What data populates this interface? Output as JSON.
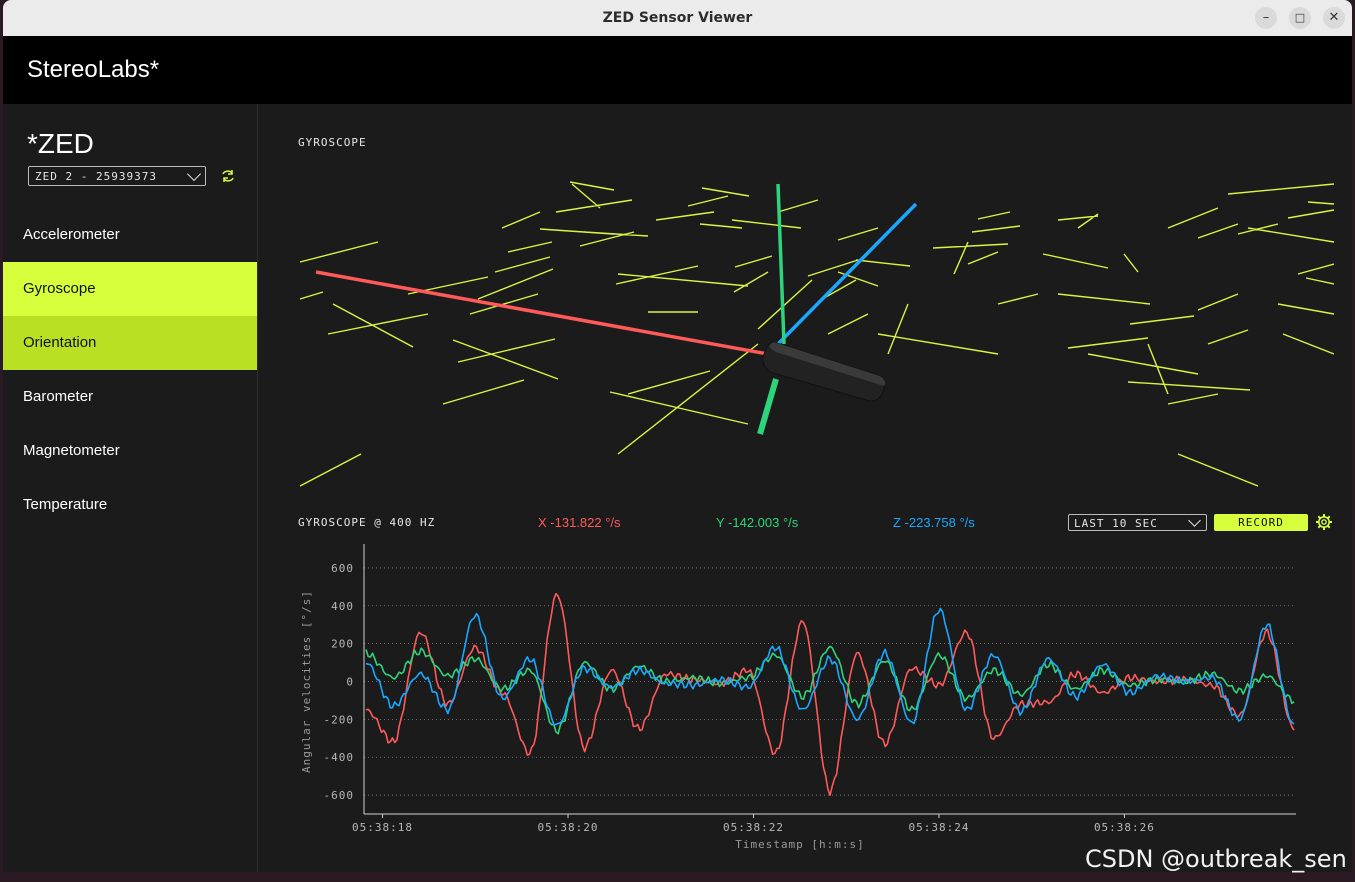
{
  "window": {
    "title": "ZED Sensor Viewer",
    "minimize": "–",
    "maximize": "□",
    "close": "✕"
  },
  "header": {
    "brand": "StereoLabs*"
  },
  "sidebar": {
    "device_title": "*ZED",
    "device_select": "ZED 2 - 25939373",
    "refresh_icon": "refresh-icon",
    "items": [
      {
        "label": "Accelerometer"
      },
      {
        "label": "Gyroscope"
      },
      {
        "label": "Orientation"
      },
      {
        "label": "Barometer"
      },
      {
        "label": "Magnetometer"
      },
      {
        "label": "Temperature"
      }
    ],
    "active_item": "Gyroscope"
  },
  "main": {
    "scene_label": "GYROSCOPE",
    "plot_label": "GYROSCOPE @  400 HZ",
    "readouts": {
      "x": "X -131.822 °/s",
      "y": "Y -142.003 °/s",
      "z": "Z -223.758 °/s"
    },
    "range_select": "LAST 10 SEC",
    "record_label": "RECORD",
    "settings_icon": "gear-icon"
  },
  "colors": {
    "accent": "#d7ff3b",
    "x": "#ff5a5a",
    "y": "#2ed47a",
    "z": "#1aa8ff",
    "grid": "#d9f542"
  },
  "chart_data": {
    "type": "line",
    "xlabel": "Timestamp [h:m:s]",
    "ylabel": "Angular velocities [°/s]",
    "ylim": [
      -700,
      700
    ],
    "yticks": [
      "600",
      "400",
      "200",
      "0",
      "-200",
      "-400",
      "-600"
    ],
    "xticks": [
      "05:38:18",
      "05:38:20",
      "05:38:22",
      "05:38:24",
      "05:38:26"
    ],
    "grid": true,
    "x": [
      "05:38:18.0",
      "05:38:18.4",
      "05:38:18.8",
      "05:38:19.2",
      "05:38:19.6",
      "05:38:20.0",
      "05:38:20.4",
      "05:38:20.8",
      "05:38:21.2",
      "05:38:21.6",
      "05:38:22.0",
      "05:38:22.4",
      "05:38:22.8",
      "05:38:23.2",
      "05:38:23.6",
      "05:38:24.0",
      "05:38:24.4",
      "05:38:24.8",
      "05:38:25.2",
      "05:38:25.6",
      "05:38:26.0",
      "05:38:26.4",
      "05:38:26.8",
      "05:38:27.2",
      "05:38:27.6",
      "05:38:27.8"
    ],
    "series": [
      {
        "name": "X",
        "values": [
          -150,
          -320,
          260,
          -120,
          180,
          -60,
          -380,
          460,
          -350,
          60,
          -250,
          40,
          10,
          -10,
          60,
          -380,
          320,
          -580,
          150,
          -330,
          70,
          -20,
          260,
          -300,
          -120,
          -110,
          40,
          -60,
          20,
          0,
          10,
          -20,
          -180,
          260,
          -250
        ]
      },
      {
        "name": "Y",
        "values": [
          150,
          20,
          160,
          30,
          120,
          -40,
          60,
          -260,
          100,
          -40,
          80,
          0,
          20,
          -10,
          20,
          140,
          -80,
          180,
          -120,
          110,
          -150,
          140,
          -90,
          60,
          -70,
          90,
          -40,
          60,
          -20,
          10,
          0,
          40,
          -50,
          30,
          -100
        ]
      },
      {
        "name": "Z",
        "values": [
          100,
          -130,
          40,
          -150,
          350,
          -90,
          120,
          -230,
          70,
          -30,
          60,
          -10,
          -20,
          10,
          -30,
          180,
          -150,
          120,
          -200,
          150,
          -220,
          380,
          -150,
          140,
          -160,
          120,
          -80,
          90,
          -60,
          30,
          0,
          20,
          -200,
          300,
          -230
        ]
      }
    ]
  }
}
